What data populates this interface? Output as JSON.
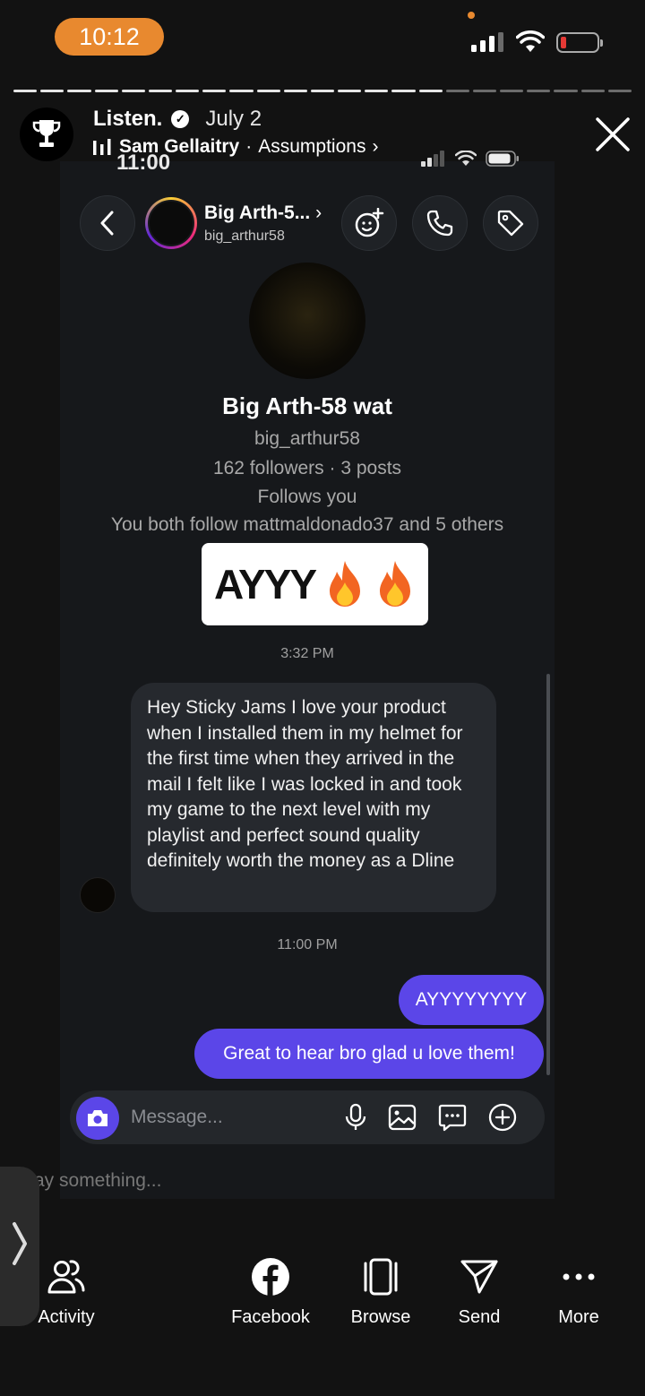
{
  "status_bar": {
    "time": "10:12"
  },
  "story": {
    "author": "Listen.",
    "date": "July 2",
    "music_artist": "Sam Gellaitry",
    "music_title": "Assumptions",
    "progress_segments_total": 23,
    "progress_segments_done": 16
  },
  "screenshot": {
    "status_time": "11:00",
    "dm": {
      "display_name": "Big Arth-5...",
      "handle": "big_arthur58"
    },
    "profile": {
      "name": "Big Arth-58 wat",
      "handle": "big_arthur58",
      "stats": "162 followers · 3 posts",
      "follows_you": "Follows you",
      "mutuals": "You both follow mattmaldonado37 and 5 others"
    },
    "sticker_text": "AYYY",
    "timestamp_1": "3:32 PM",
    "incoming_message": "Hey Sticky Jams I love your product when I installed them in my helmet for the first time when they arrived in the mail I felt like I was locked in and took my game to the next level with my playlist and perfect sound quality definitely worth the money as a Dline",
    "timestamp_2": "11:00 PM",
    "outgoing_1": "AYYYYYYYY",
    "outgoing_2": "Great to hear bro glad u love them!",
    "composer_placeholder": "Message..."
  },
  "reply_placeholder": "ay something...",
  "bottom_nav": {
    "activity": "Activity",
    "facebook": "Facebook",
    "browse": "Browse",
    "send": "Send",
    "more": "More"
  },
  "colors": {
    "accent_orange": "#e8892f",
    "message_purple": "#5b46e8",
    "background": "#121212"
  }
}
